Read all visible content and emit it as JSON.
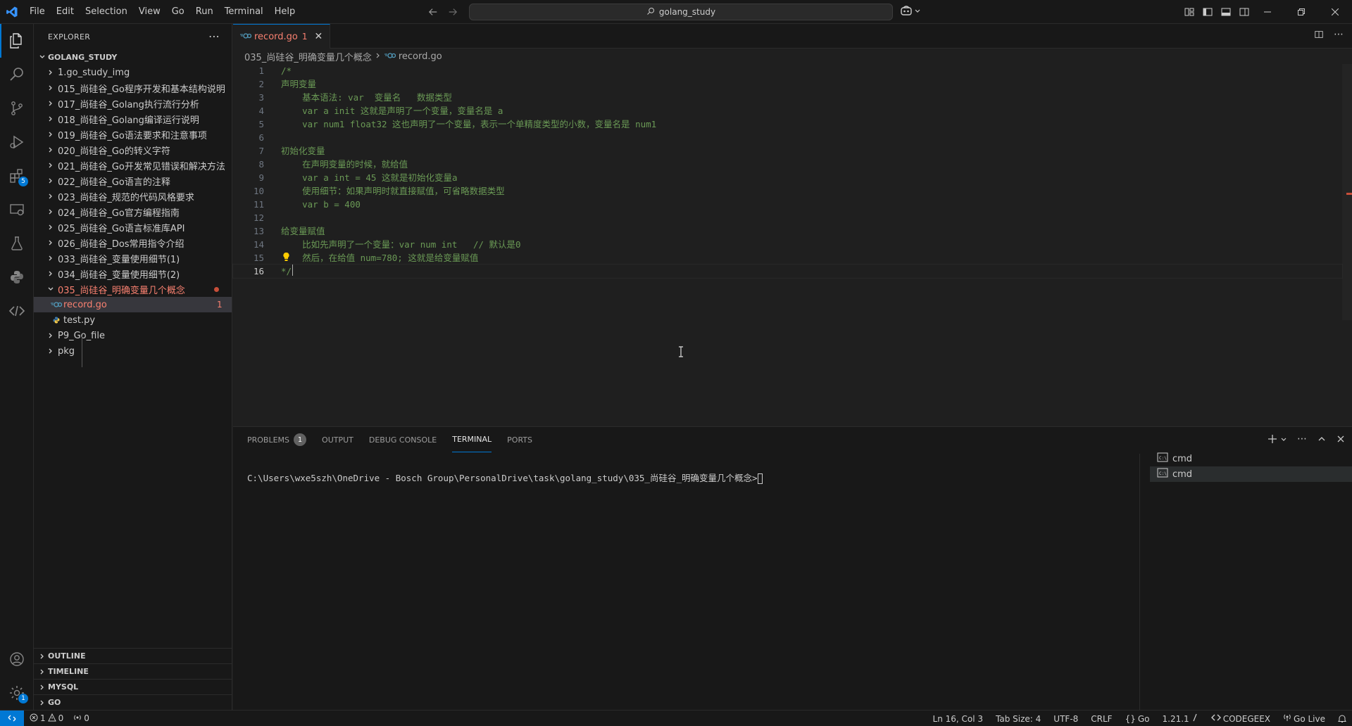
{
  "menu": [
    "File",
    "Edit",
    "Selection",
    "View",
    "Go",
    "Run",
    "Terminal",
    "Help"
  ],
  "command_center": {
    "text": "golang_study"
  },
  "activity_badges": {
    "extensions": "5",
    "settings": "1"
  },
  "sidebar": {
    "title": "EXPLORER",
    "root": "GOLANG_STUDY",
    "items": [
      {
        "label": "1.go_study_img",
        "type": "folder"
      },
      {
        "label": "015_尚硅谷_Go程序开发和基本结构说明",
        "type": "folder"
      },
      {
        "label": "017_尚硅谷_Golang执行流行分析",
        "type": "folder"
      },
      {
        "label": "018_尚硅谷_Golang编译运行说明",
        "type": "folder"
      },
      {
        "label": "019_尚硅谷_Go语法要求和注意事项",
        "type": "folder"
      },
      {
        "label": "020_尚硅谷_Go的转义字符",
        "type": "folder"
      },
      {
        "label": "021_尚硅谷_Go开发常见错误和解决方法",
        "type": "folder"
      },
      {
        "label": "022_尚硅谷_Go语言的注释",
        "type": "folder"
      },
      {
        "label": "023_尚硅谷_规范的代码风格要求",
        "type": "folder"
      },
      {
        "label": "024_尚硅谷_Go官方编程指南",
        "type": "folder"
      },
      {
        "label": "025_尚硅谷_Go语言标准库API",
        "type": "folder"
      },
      {
        "label": "026_尚硅谷_Dos常用指令介绍",
        "type": "folder"
      },
      {
        "label": "033_尚硅谷_变量使用细节(1)",
        "type": "folder"
      },
      {
        "label": "034_尚硅谷_变量使用细节(2)",
        "type": "folder"
      },
      {
        "label": "035_尚硅谷_明确变量几个概念",
        "type": "folder-open"
      },
      {
        "label": "record.go",
        "type": "file-go",
        "count": "1"
      },
      {
        "label": "test.py",
        "type": "file-py"
      },
      {
        "label": "P9_Go_file",
        "type": "folder"
      },
      {
        "label": "pkg",
        "type": "folder"
      }
    ],
    "sections": [
      "OUTLINE",
      "TIMELINE",
      "MYSQL",
      "GO"
    ]
  },
  "editor": {
    "tab": {
      "label": "record.go",
      "count": "1",
      "badge": "GO"
    },
    "breadcrumb": [
      "035_尚硅谷_明确变量几个概念",
      "record.go"
    ],
    "lines": [
      "/*",
      "声明变量",
      "    基本语法: var  变量名   数据类型",
      "    var a init 这就是声明了一个变量，变量名是 a",
      "    var num1 float32 这也声明了一个变量，表示一个单精度类型的小数，变量名是 num1",
      "",
      "初始化变量",
      "    在声明变量的时候，就给值",
      "    var a int = 45 这就是初始化变量a",
      "    使用细节：如果声明时就直接赋值，可省略数据类型",
      "    var b = 400",
      "",
      "给变量赋值",
      "    比如先声明了一个变量：var num int   // 默认是0",
      "    然后，在给值 num=780; 这就是给变量赋值",
      "*/"
    ]
  },
  "panel": {
    "tabs": [
      "PROBLEMS",
      "OUTPUT",
      "DEBUG CONSOLE",
      "TERMINAL",
      "PORTS"
    ],
    "problems_count": "1",
    "active_tab": "TERMINAL",
    "terminal_prompt": "C:\\Users\\wxe5szh\\OneDrive - Bosch Group\\PersonalDrive\\task\\golang_study\\035_尚硅谷_明确变量几个概念>",
    "terminals": [
      "cmd",
      "cmd"
    ]
  },
  "status": {
    "errors": "1",
    "warnings": "0",
    "ports": "0",
    "position": "Ln 16, Col 3",
    "tab_size": "Tab Size: 4",
    "encoding": "UTF-8",
    "eol": "CRLF",
    "language": "Go",
    "go_version": "1.21.1",
    "codegeex": "CODEGEEX",
    "go_live": "Go Live"
  }
}
